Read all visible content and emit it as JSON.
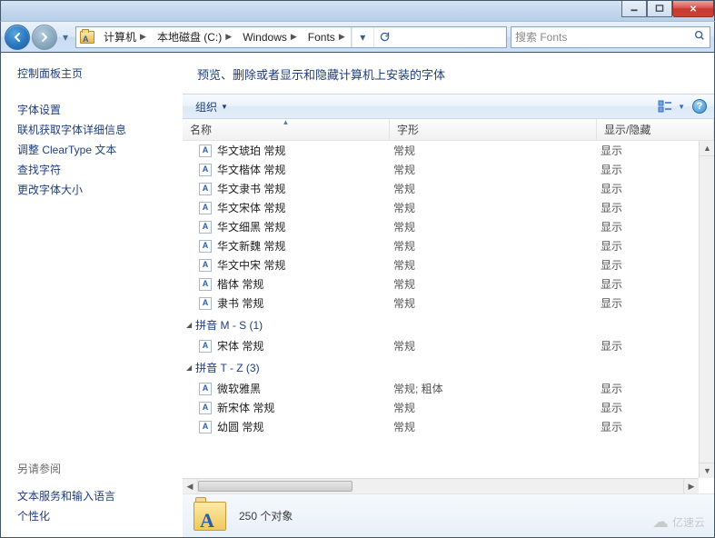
{
  "breadcrumbs": [
    "计算机",
    "本地磁盘 (C:)",
    "Windows",
    "Fonts"
  ],
  "search_placeholder": "搜索 Fonts",
  "sidebar": {
    "title": "控制面板主页",
    "links": [
      "字体设置",
      "联机获取字体详细信息",
      "调整 ClearType 文本",
      "查找字符",
      "更改字体大小"
    ],
    "see_also_label": "另请参阅",
    "see_also": [
      "文本服务和输入语言",
      "个性化"
    ]
  },
  "heading": "预览、删除或者显示和隐藏计算机上安装的字体",
  "toolbar": {
    "organize": "组织"
  },
  "columns": {
    "name": "名称",
    "style": "字形",
    "show": "显示/隐藏"
  },
  "groups": [
    {
      "items": [
        {
          "name": "华文琥珀 常规",
          "style": "常规",
          "show": "显示"
        },
        {
          "name": "华文楷体 常规",
          "style": "常规",
          "show": "显示"
        },
        {
          "name": "华文隶书 常规",
          "style": "常规",
          "show": "显示"
        },
        {
          "name": "华文宋体 常规",
          "style": "常规",
          "show": "显示"
        },
        {
          "name": "华文细黑 常规",
          "style": "常规",
          "show": "显示"
        },
        {
          "name": "华文新魏 常规",
          "style": "常规",
          "show": "显示"
        },
        {
          "name": "华文中宋 常规",
          "style": "常规",
          "show": "显示"
        },
        {
          "name": "楷体 常规",
          "style": "常规",
          "show": "显示"
        },
        {
          "name": "隶书 常规",
          "style": "常规",
          "show": "显示"
        }
      ]
    },
    {
      "label": "拼音 M - S (1)",
      "items": [
        {
          "name": "宋体 常规",
          "style": "常规",
          "show": "显示"
        }
      ]
    },
    {
      "label": "拼音 T - Z (3)",
      "items": [
        {
          "name": "微软雅黑",
          "style": "常规; 粗体",
          "show": "显示"
        },
        {
          "name": "新宋体 常规",
          "style": "常规",
          "show": "显示"
        },
        {
          "name": "幼圆 常规",
          "style": "常规",
          "show": "显示"
        }
      ]
    }
  ],
  "status": {
    "count_text": "250 个对象"
  },
  "watermark": "亿速云"
}
